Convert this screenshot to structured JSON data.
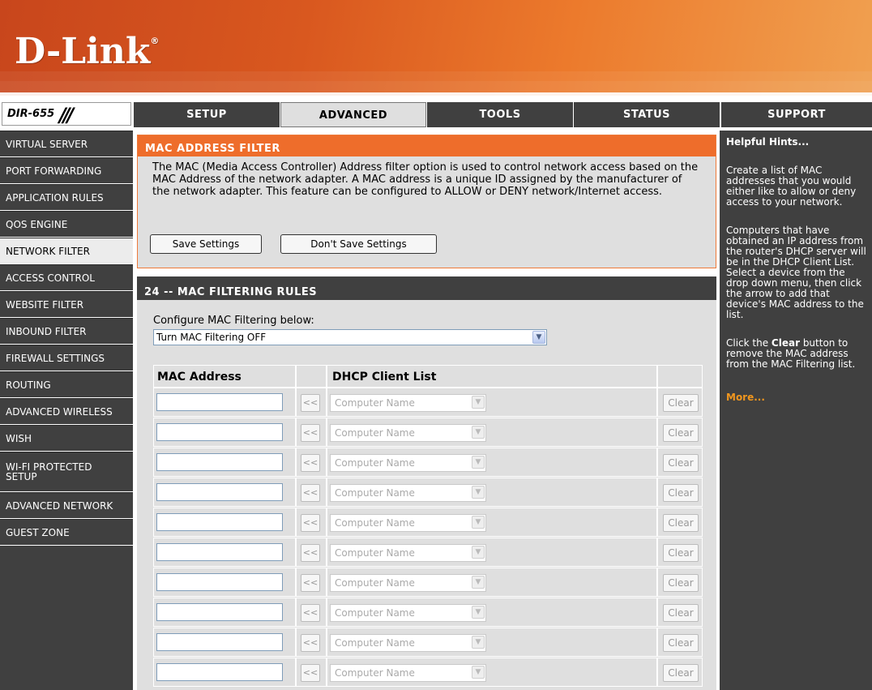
{
  "brand": {
    "logo": "D-Link",
    "registered": "®",
    "model": "DIR-655",
    "model_slashes": "///"
  },
  "tabs": [
    {
      "label": "SETUP",
      "active": false
    },
    {
      "label": "ADVANCED",
      "active": true
    },
    {
      "label": "TOOLS",
      "active": false
    },
    {
      "label": "STATUS",
      "active": false
    },
    {
      "label": "SUPPORT",
      "active": false
    }
  ],
  "sidebar": {
    "items": [
      {
        "label": "VIRTUAL SERVER"
      },
      {
        "label": "PORT FORWARDING"
      },
      {
        "label": "APPLICATION RULES"
      },
      {
        "label": "QOS ENGINE"
      },
      {
        "label": "NETWORK FILTER",
        "active": true
      },
      {
        "label": "ACCESS CONTROL"
      },
      {
        "label": "WEBSITE FILTER"
      },
      {
        "label": "INBOUND FILTER"
      },
      {
        "label": "FIREWALL SETTINGS"
      },
      {
        "label": "ROUTING"
      },
      {
        "label": "ADVANCED WIRELESS"
      },
      {
        "label": "WISH"
      },
      {
        "label": "WI-FI PROTECTED SETUP"
      },
      {
        "label": "ADVANCED NETWORK"
      },
      {
        "label": "GUEST ZONE"
      }
    ]
  },
  "filter": {
    "title": "MAC ADDRESS FILTER",
    "description": "The MAC (Media Access Controller) Address filter option is used to control network access based on the MAC Address of the network adapter. A MAC address is a unique ID assigned by the manufacturer of the network adapter. This feature can be configured to ALLOW or DENY network/Internet access.",
    "save_label": "Save Settings",
    "dont_save_label": "Don't Save Settings"
  },
  "rules": {
    "title": "24 -- MAC FILTERING RULES",
    "configure_label": "Configure MAC Filtering below:",
    "mode_value": "Turn MAC Filtering OFF",
    "col_mac": "MAC Address",
    "col_dhcp": "DHCP Client List",
    "add_label": "<<",
    "dhcp_placeholder": "Computer Name",
    "clear_label": "Clear",
    "row_count": 10
  },
  "hints": {
    "title": "Helpful Hints...",
    "p1": "Create a list of MAC addresses that you would either like to allow or deny access to your network.",
    "p2": "Computers that have obtained an IP address from the router's DHCP server will be in the DHCP Client List. Select a device from the drop down menu, then click the arrow to add that device's MAC address to the list.",
    "p3_prefix": "Click the ",
    "p3_bold": "Clear",
    "p3_suffix": " button to remove the MAC address from the MAC Filtering list.",
    "more": "More..."
  },
  "colors": {
    "orange": "#ee6d2b",
    "dark": "#404040",
    "panel": "#dfdfdf",
    "more": "#f0961e"
  }
}
